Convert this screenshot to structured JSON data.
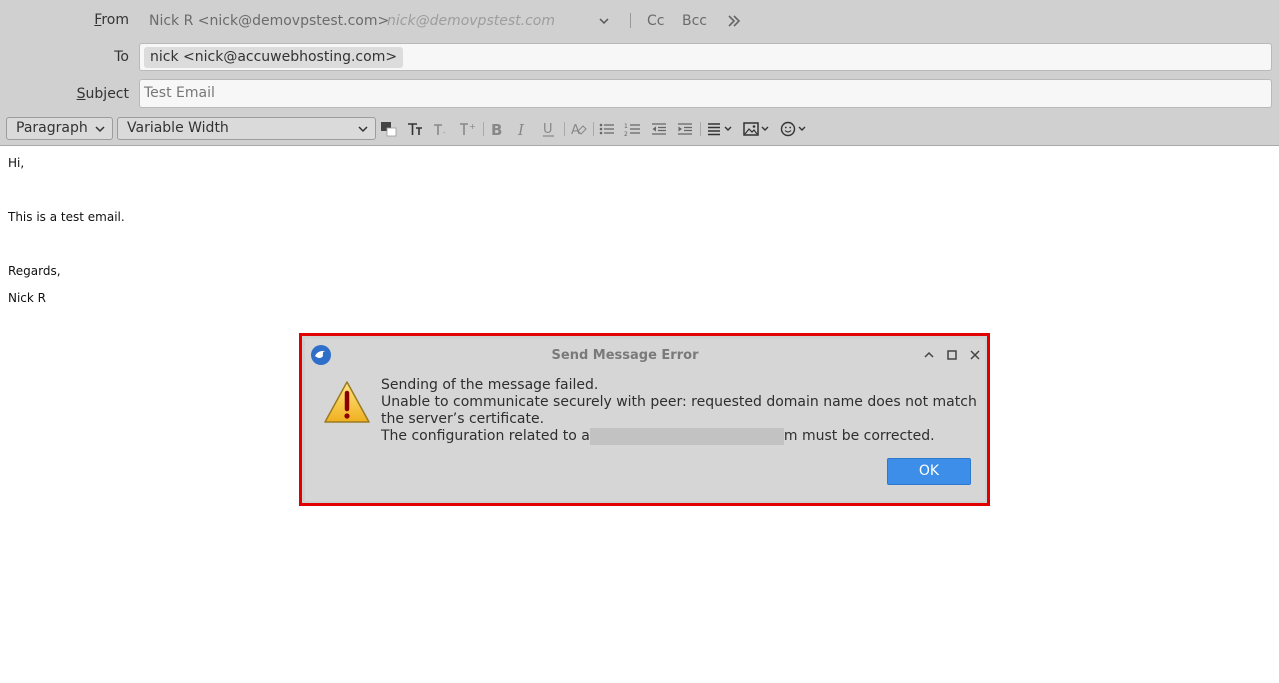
{
  "header": {
    "from_label_pre": "",
    "from_label_accel": "F",
    "from_label_post": "rom",
    "from_value": "Nick R <nick@demovpstest.com>",
    "from_placeholder": "nick@demovpstest.com",
    "cc_label": "Cc",
    "bcc_label": "Bcc",
    "to_label": "To",
    "to_recipient": "nick <nick@accuwebhosting.com>",
    "subject_label_accel": "S",
    "subject_label_post": "ubject",
    "subject_value": "Test Email"
  },
  "toolbar": {
    "paragraph_format": "Paragraph",
    "font_width": "Variable Width",
    "icons": [
      "text-color-icon",
      "font-size-icon",
      "smaller-text-icon",
      "larger-text-icon",
      "bold-icon",
      "italic-icon",
      "underline-icon",
      "remove-formatting-icon",
      "bullet-list-icon",
      "numbered-list-icon",
      "outdent-icon",
      "indent-icon",
      "align-icon",
      "insert-image-icon",
      "emoji-icon"
    ]
  },
  "body": {
    "lines": [
      "Hi,",
      "",
      "This is a test email.",
      "",
      "Regards,",
      "Nick R"
    ]
  },
  "dialog": {
    "title": "Send Message Error",
    "line1": "Sending of the message failed.",
    "line2": "Unable to communicate securely with peer: requested domain name does not match",
    "line3": "the server’s certificate.",
    "line4_pre": "The configuration related to a",
    "line4_post": "m must be corrected.",
    "ok_label": "OK"
  },
  "colors": {
    "header_bg": "#d0d0d0",
    "dialog_highlight": "#e00000",
    "ok_button": "#3d8ee8"
  }
}
